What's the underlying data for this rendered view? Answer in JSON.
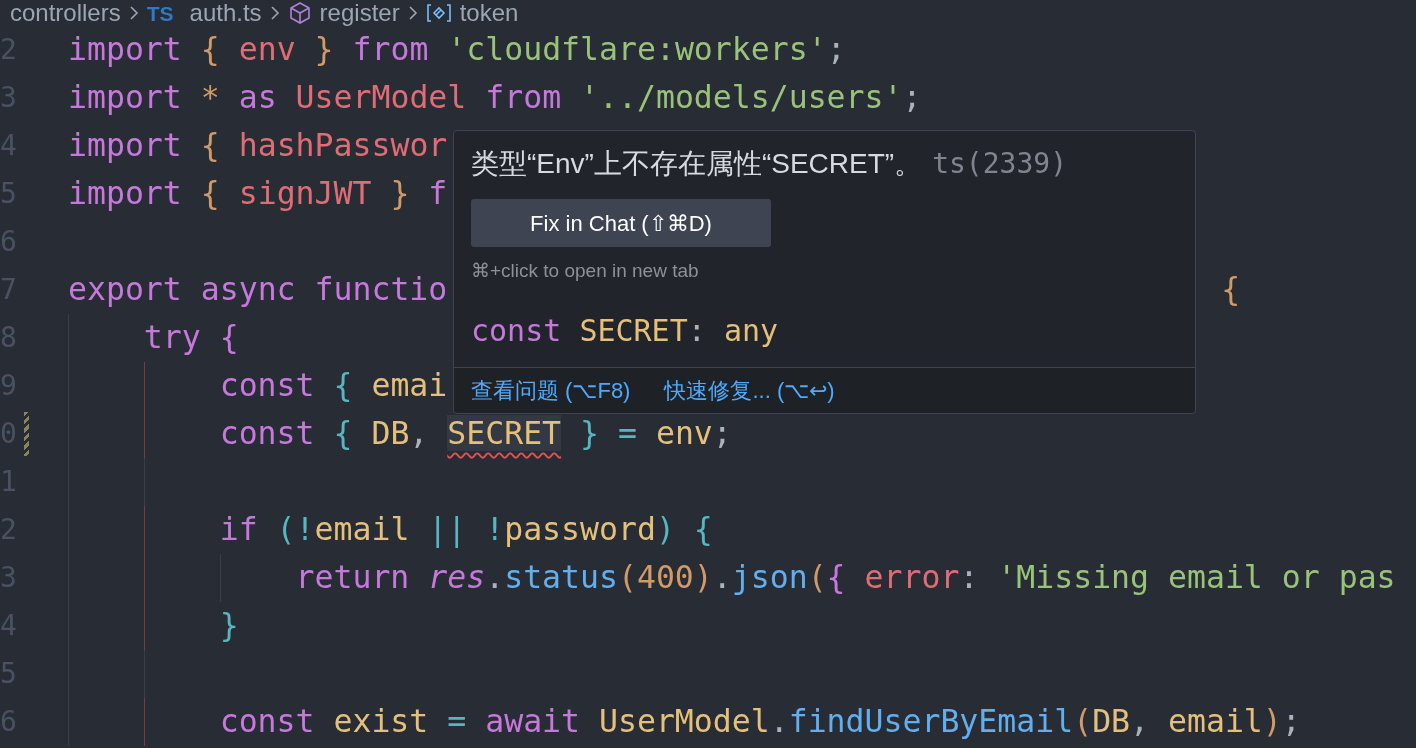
{
  "breadcrumb": [
    {
      "label": "controllers",
      "kind": "folder"
    },
    {
      "label": "auth.ts",
      "kind": "ts",
      "icon_text": "TS"
    },
    {
      "label": "register",
      "kind": "function"
    },
    {
      "label": "token",
      "kind": "variable"
    }
  ],
  "code_lines": [
    {
      "number": "2",
      "modified": false,
      "tokens": [
        {
          "text": "import ",
          "kind": "kw"
        },
        {
          "text": "{",
          "kind": "b1"
        },
        {
          "text": " env ",
          "kind": "var"
        },
        {
          "text": "}",
          "kind": "b1"
        },
        {
          "text": " from ",
          "kind": "kw"
        },
        {
          "text": "'cloudflare:workers'",
          "kind": "str"
        },
        {
          "text": ";",
          "kind": "punct"
        }
      ]
    },
    {
      "number": "3",
      "modified": false,
      "tokens": [
        {
          "text": "import ",
          "kind": "kw"
        },
        {
          "text": "*",
          "kind": "b1"
        },
        {
          "text": " as ",
          "kind": "kw"
        },
        {
          "text": "UserModel",
          "kind": "var"
        },
        {
          "text": " from ",
          "kind": "kw"
        },
        {
          "text": "'../models/users'",
          "kind": "str"
        },
        {
          "text": ";",
          "kind": "punct"
        }
      ]
    },
    {
      "number": "4",
      "modified": false,
      "tokens": [
        {
          "text": "import ",
          "kind": "kw"
        },
        {
          "text": "{",
          "kind": "b1"
        },
        {
          "text": " hashPasswor",
          "kind": "var"
        }
      ]
    },
    {
      "number": "5",
      "modified": false,
      "tokens": [
        {
          "text": "import ",
          "kind": "kw"
        },
        {
          "text": "{",
          "kind": "b1"
        },
        {
          "text": " signJWT ",
          "kind": "var"
        },
        {
          "text": "}",
          "kind": "b1"
        },
        {
          "text": " f",
          "kind": "kw"
        }
      ]
    },
    {
      "number": "6",
      "modified": false
    },
    {
      "number": "7",
      "modified": false,
      "tokens": [
        {
          "text": "export async functio",
          "kind": "kw"
        }
      ],
      "tokens_after_popup": [
        {
          "text": "{",
          "kind": "b1"
        }
      ]
    },
    {
      "number": "8",
      "modified": false,
      "indent_guides": [
        {
          "highlighted": false
        }
      ],
      "tokens": [
        {
          "text": "try ",
          "kind": "kw"
        },
        {
          "text": "{",
          "kind": "b2"
        }
      ]
    },
    {
      "number": "9",
      "modified": false,
      "indent_guides": [
        {
          "highlighted": false
        },
        {
          "highlighted": true
        }
      ],
      "tokens": [
        {
          "text": "const ",
          "kind": "kw"
        },
        {
          "text": "{",
          "kind": "b3"
        },
        {
          "text": " emai",
          "kind": "const"
        }
      ]
    },
    {
      "number": "0",
      "modified": true,
      "indent_guides": [
        {
          "highlighted": false
        },
        {
          "highlighted": true
        }
      ],
      "tokens": [
        {
          "text": "const ",
          "kind": "kw"
        },
        {
          "text": "{",
          "kind": "b3"
        },
        {
          "text": " DB",
          "kind": "const"
        },
        {
          "text": ", ",
          "kind": "punct"
        },
        {
          "text": "SECRET",
          "kind": "const",
          "error": true
        },
        {
          "text": " }",
          "kind": "b3"
        },
        {
          "text": " = ",
          "kind": "op"
        },
        {
          "text": "env",
          "kind": "const"
        },
        {
          "text": ";",
          "kind": "punct"
        }
      ]
    },
    {
      "number": "1",
      "modified": false,
      "indent_guides": [
        {
          "highlighted": false
        },
        {
          "highlighted": false
        }
      ]
    },
    {
      "number": "2",
      "modified": false,
      "indent_guides": [
        {
          "highlighted": false
        },
        {
          "highlighted": true
        }
      ],
      "tokens": [
        {
          "text": "if ",
          "kind": "kw"
        },
        {
          "text": "(!",
          "kind": "b3"
        },
        {
          "text": "email",
          "kind": "const"
        },
        {
          "text": " || !",
          "kind": "op"
        },
        {
          "text": "password",
          "kind": "const"
        },
        {
          "text": ") {",
          "kind": "b3"
        }
      ]
    },
    {
      "number": "3",
      "modified": false,
      "indent_guides": [
        {
          "highlighted": false
        },
        {
          "highlighted": true
        },
        {
          "highlighted": false
        }
      ],
      "tokens": [
        {
          "text": "return ",
          "kind": "kw"
        },
        {
          "text": "res",
          "kind": "param"
        },
        {
          "text": ".",
          "kind": "punct"
        },
        {
          "text": "status",
          "kind": "fn"
        },
        {
          "text": "(",
          "kind": "b1"
        },
        {
          "text": "400",
          "kind": "num"
        },
        {
          "text": ")",
          "kind": "b1"
        },
        {
          "text": ".",
          "kind": "punct"
        },
        {
          "text": "json",
          "kind": "fn"
        },
        {
          "text": "(",
          "kind": "b1"
        },
        {
          "text": "{",
          "kind": "b2"
        },
        {
          "text": " error",
          "kind": "var"
        },
        {
          "text": ": ",
          "kind": "punct"
        },
        {
          "text": "'Missing email or pas",
          "kind": "str"
        }
      ]
    },
    {
      "number": "4",
      "modified": false,
      "indent_guides": [
        {
          "highlighted": false
        },
        {
          "highlighted": true
        }
      ],
      "tokens": [
        {
          "text": "}",
          "kind": "b3"
        }
      ]
    },
    {
      "number": "5",
      "modified": false,
      "indent_guides": [
        {
          "highlighted": false
        },
        {
          "highlighted": false
        }
      ]
    },
    {
      "number": "6",
      "modified": false,
      "indent_guides": [
        {
          "highlighted": false
        },
        {
          "highlighted": true
        }
      ],
      "tokens": [
        {
          "text": "const",
          "kind": "kw"
        },
        {
          "text": " exist ",
          "kind": "const"
        },
        {
          "text": "= ",
          "kind": "op"
        },
        {
          "text": "await",
          "kind": "kw"
        },
        {
          "text": " UserModel",
          "kind": "const"
        },
        {
          "text": ".",
          "kind": "punct"
        },
        {
          "text": "findUserByEmail",
          "kind": "fn"
        },
        {
          "text": "(",
          "kind": "b1"
        },
        {
          "text": "DB",
          "kind": "const"
        },
        {
          "text": ", ",
          "kind": "punct"
        },
        {
          "text": "email",
          "kind": "const"
        },
        {
          "text": ")",
          "kind": "b1"
        },
        {
          "text": ";",
          "kind": "punct"
        }
      ]
    }
  ],
  "hover_popup": {
    "message": "类型“Env”上不存在属性“SECRET”。",
    "code": "ts(2339)",
    "fix_button": "Fix in Chat (⇧⌘D)",
    "hint": "⌘+click to open in new tab",
    "signature": [
      {
        "text": "const ",
        "kind": "kw"
      },
      {
        "text": "SECRET",
        "kind": "const"
      },
      {
        "text": ": ",
        "kind": "punct"
      },
      {
        "text": "any",
        "kind": "const"
      }
    ],
    "actions": [
      "查看问题 (⌥F8)",
      "快速修复... (⌥↩)"
    ]
  }
}
